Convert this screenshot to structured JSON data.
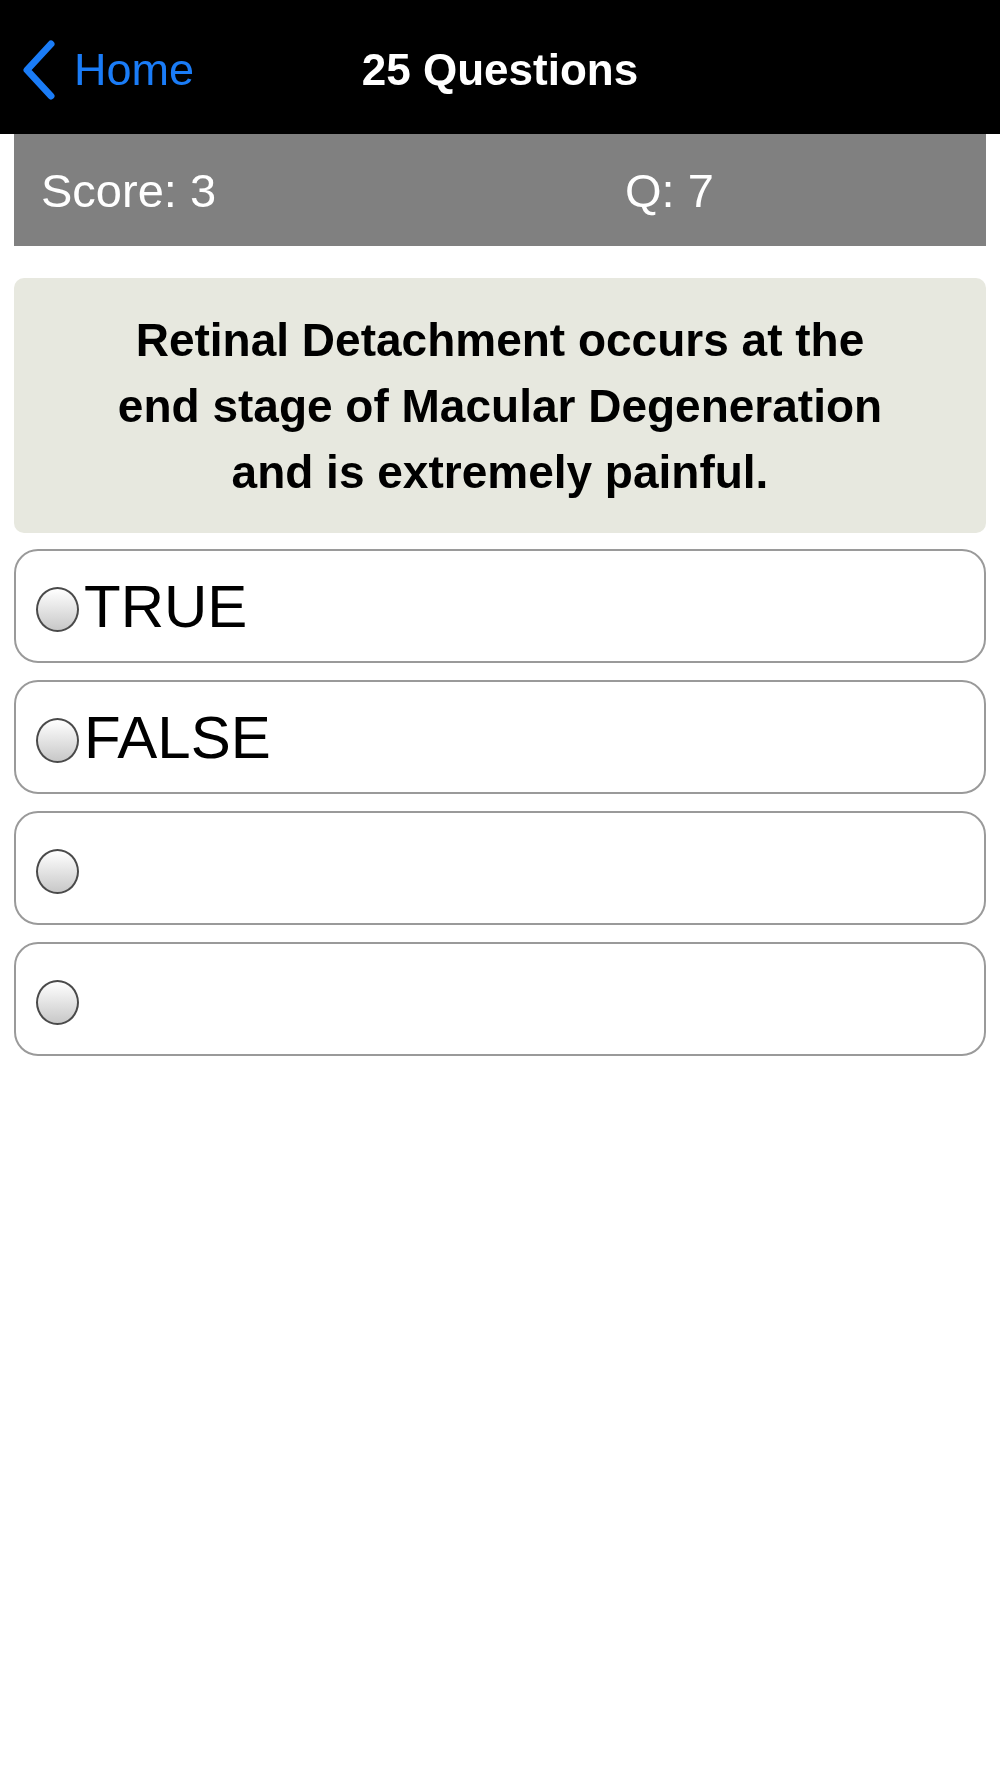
{
  "nav_bar": {
    "back_label": "Home",
    "title": "25 Questions"
  },
  "status": {
    "score": "Score: 3",
    "question": "Q: 7"
  },
  "question": {
    "text": "Retinal Detachment occurs at the end stage of Macular Degeneration and is extremely painful."
  },
  "options": [
    {
      "label": "TRUE",
      "selected": false
    },
    {
      "label": "FALSE",
      "selected": false
    },
    {
      "selected": false
    },
    {
      "selected": false
    }
  ]
}
